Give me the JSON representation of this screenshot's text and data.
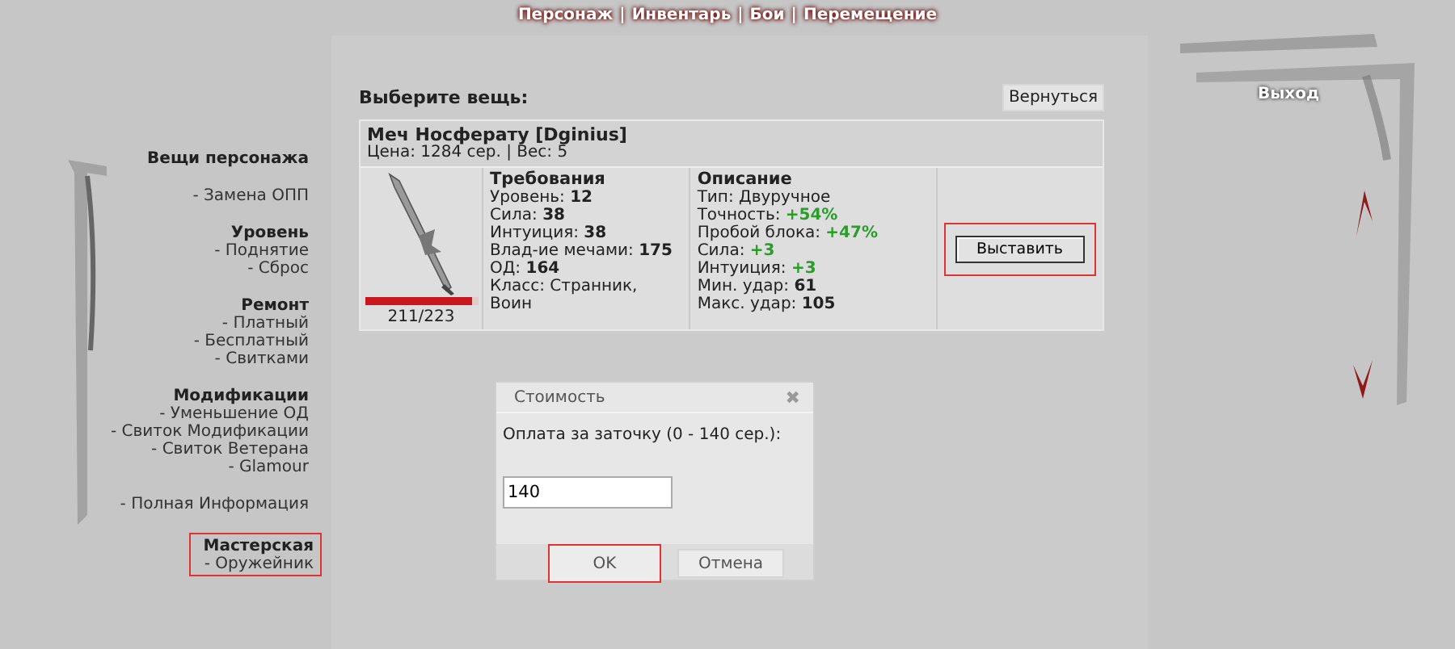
{
  "top_nav": {
    "separator": "|",
    "items": [
      "Персонаж",
      "Инвентарь",
      "Бои",
      "Перемещение"
    ]
  },
  "exit_button": "Выход",
  "sidebar": {
    "sections": [
      {
        "title": "Вещи персонажа",
        "highlighted": false
      },
      {
        "links": [
          "- Замена ОПП"
        ],
        "highlighted": false
      },
      {
        "title": "Уровень",
        "links": [
          "- Поднятие",
          "- Сброс"
        ],
        "highlighted": false
      },
      {
        "title": "Ремонт",
        "links": [
          "- Платный",
          "- Бесплатный",
          "- Свитками"
        ],
        "highlighted": false
      },
      {
        "title": "Модификации",
        "links": [
          "- Уменьшение ОД",
          "- Свиток Модификации",
          "- Свиток Ветерана",
          "- Glamour"
        ],
        "highlighted": false
      },
      {
        "links": [
          "- Полная Информация"
        ],
        "highlighted": false
      },
      {
        "title": "Мастерская",
        "links": [
          "- Оружейник"
        ],
        "highlighted": true
      }
    ]
  },
  "panel": {
    "heading": "Выберите вещь:",
    "back_button": "Вернуться",
    "item": {
      "name": "Меч Носферату [Dginius]",
      "meta": "Цена: 1284 сер. | Вес: 5",
      "durability": {
        "text": "211/223",
        "level": 0.946
      },
      "requirements": {
        "title": "Требования",
        "lines": [
          {
            "label": "Уровень: ",
            "value": "12",
            "kind": "bold"
          },
          {
            "label": "Сила: ",
            "value": "38",
            "kind": "bold"
          },
          {
            "label": "Интуиция: ",
            "value": "38",
            "kind": "bold"
          },
          {
            "label": "Влад-ие мечами: ",
            "value": "175",
            "kind": "bold"
          },
          {
            "label": "ОД: ",
            "value": "164",
            "kind": "bold"
          },
          {
            "label": "Класс: Странник, Воин",
            "kind": "plain"
          }
        ]
      },
      "description": {
        "title": "Описание",
        "lines": [
          {
            "label": "Тип: Двуручное",
            "kind": "plain"
          },
          {
            "label": "Точность: ",
            "value": "+54%",
            "kind": "bonus"
          },
          {
            "label": "Пробой блока: ",
            "value": "+47%",
            "kind": "bonus"
          },
          {
            "label": "Сила: ",
            "value": "+3",
            "kind": "bonus"
          },
          {
            "label": "Интуиция: ",
            "value": "+3",
            "kind": "bonus"
          },
          {
            "label": "Мин. удар: ",
            "value": "61",
            "kind": "bold"
          },
          {
            "label": "Макс. удар: ",
            "value": "105",
            "kind": "bold"
          }
        ]
      },
      "action": {
        "label": "Выставить",
        "highlighted": true
      }
    }
  },
  "dialog": {
    "title": "Стоимость",
    "close": "✖",
    "prompt": "Оплата за заточку (0 - 140 сер.):",
    "value": "140",
    "buttons": [
      {
        "label": "OK",
        "highlighted": true
      },
      {
        "label": "Отмена",
        "highlighted": false
      }
    ]
  }
}
